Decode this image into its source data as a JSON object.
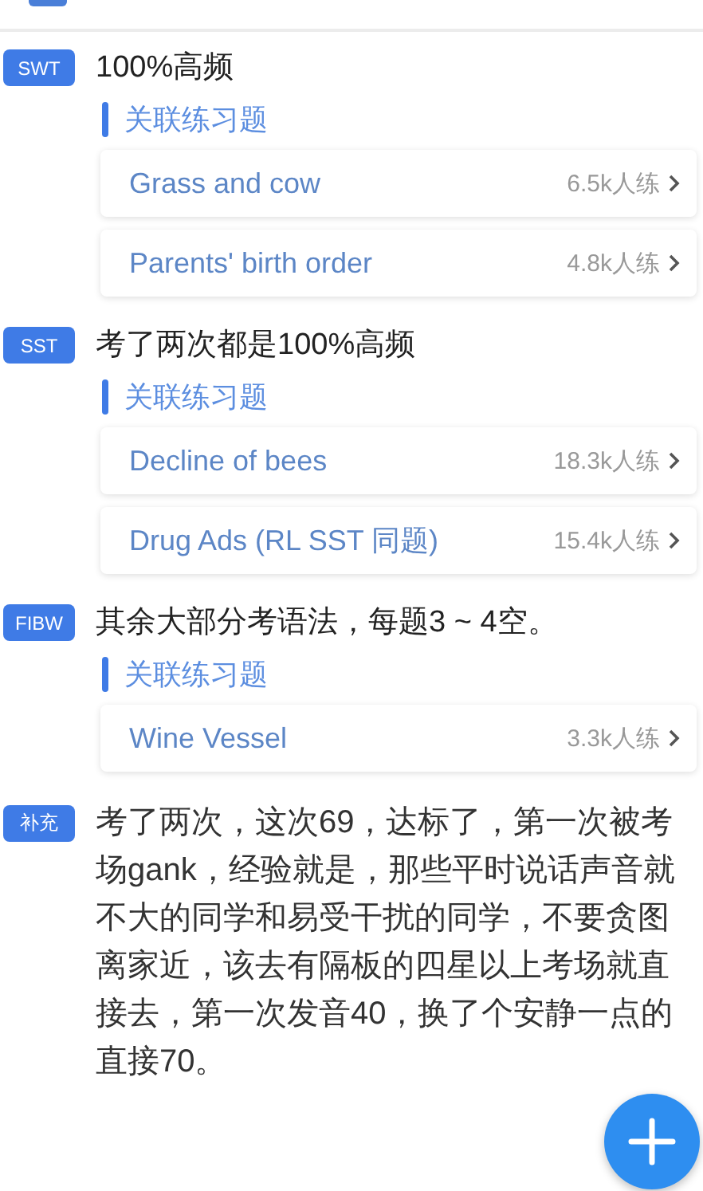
{
  "sections": [
    {
      "tag": "SWT",
      "title": "100%高频",
      "related_label": "关联练习题",
      "exercises": [
        {
          "title": "Grass and cow",
          "count": "6.5k人练"
        },
        {
          "title": "Parents' birth order",
          "count": "4.8k人练"
        }
      ]
    },
    {
      "tag": "SST",
      "title": "考了两次都是100%高频",
      "related_label": "关联练习题",
      "exercises": [
        {
          "title": "Decline of bees",
          "count": "18.3k人练"
        },
        {
          "title": "Drug Ads (RL SST 同题)",
          "count": "15.4k人练"
        }
      ]
    },
    {
      "tag": "FIBW",
      "title": "其余大部分考语法，每题3 ~ 4空。",
      "related_label": "关联练习题",
      "exercises": [
        {
          "title": "Wine Vessel",
          "count": "3.3k人练"
        }
      ]
    }
  ],
  "supplement": {
    "tag": "补充",
    "text": "考了两次，这次69，达标了，第一次被考场gank，经验就是，那些平时说话声音就不大的同学和易受干扰的同学，不要贪图离家近，该去有隔板的四星以上考场就直接去，第一次发音40，换了个安静一点的直接70。"
  }
}
